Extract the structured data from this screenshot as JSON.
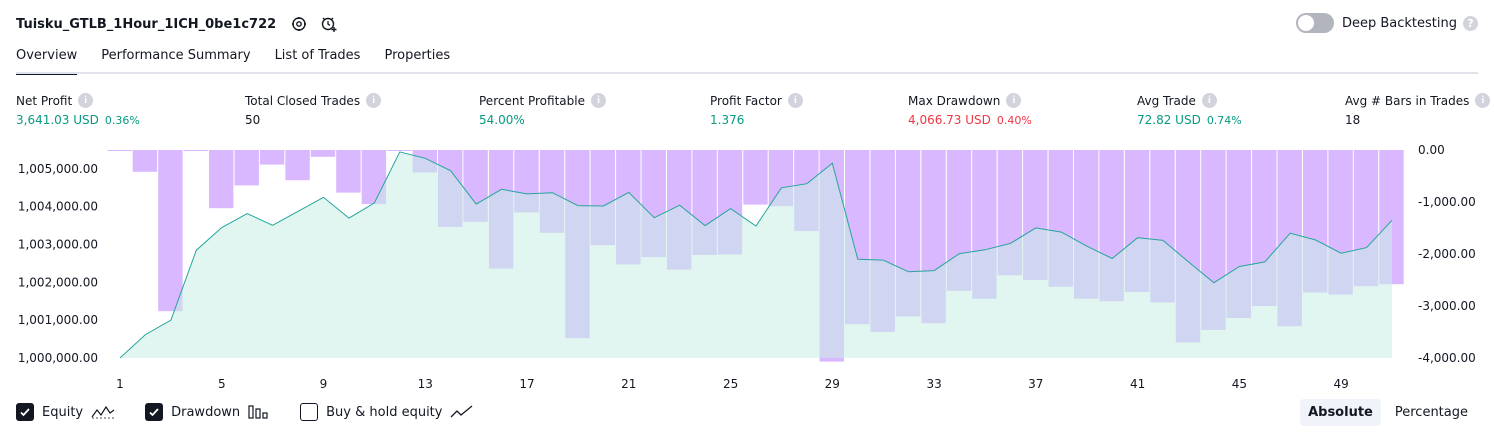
{
  "header": {
    "strategy_name": "Tuisku_GTLB_1Hour_1ICH_0be1c722",
    "deep_backtesting_label": "Deep Backtesting"
  },
  "tabs": [
    {
      "label": "Overview",
      "active": true
    },
    {
      "label": "Performance Summary",
      "active": false
    },
    {
      "label": "List of Trades",
      "active": false
    },
    {
      "label": "Properties",
      "active": false
    }
  ],
  "metrics": {
    "net_profit": {
      "label": "Net Profit",
      "value": "3,641.03 USD",
      "pct": "0.36%"
    },
    "total_closed_trades": {
      "label": "Total Closed Trades",
      "value": "50"
    },
    "percent_profitable": {
      "label": "Percent Profitable",
      "value": "54.00%"
    },
    "profit_factor": {
      "label": "Profit Factor",
      "value": "1.376"
    },
    "max_drawdown": {
      "label": "Max Drawdown",
      "value": "4,066.73 USD",
      "pct": "0.40%"
    },
    "avg_trade": {
      "label": "Avg Trade",
      "value": "72.82 USD",
      "pct": "0.74%"
    },
    "avg_bars": {
      "label": "Avg # Bars in Trades",
      "value": "18"
    }
  },
  "colors": {
    "equity_line": "#26a69a",
    "equity_fill": "#c8ede5",
    "drawdown_bar": "#d9b8ff",
    "positive": "#089981",
    "negative": "#f23645"
  },
  "legend": {
    "equity": {
      "label": "Equity",
      "checked": true,
      "icon": "equity-line-icon"
    },
    "drawdown": {
      "label": "Drawdown",
      "checked": true,
      "icon": "drawdown-bars-icon"
    },
    "buy_hold": {
      "label": "Buy & hold equity",
      "checked": false,
      "icon": "buy-hold-line-icon"
    }
  },
  "mode": {
    "absolute_label": "Absolute",
    "percentage_label": "Percentage",
    "selected": "Absolute"
  },
  "chart_data": {
    "type": "line",
    "x": [
      1,
      2,
      3,
      4,
      5,
      6,
      7,
      8,
      9,
      10,
      11,
      12,
      13,
      14,
      15,
      16,
      17,
      18,
      19,
      20,
      21,
      22,
      23,
      24,
      25,
      26,
      27,
      28,
      29,
      30,
      31,
      32,
      33,
      34,
      35,
      36,
      37,
      38,
      39,
      40,
      41,
      42,
      43,
      44,
      45,
      46,
      47,
      48,
      49,
      50,
      51
    ],
    "x_ticks": [
      "1",
      "5",
      "9",
      "13",
      "17",
      "21",
      "25",
      "29",
      "33",
      "37",
      "41",
      "45",
      "49"
    ],
    "y_left_ticks": [
      "1,000,000.00",
      "1,001,000.00",
      "1,002,000.00",
      "1,003,000.00",
      "1,004,000.00",
      "1,005,000.00"
    ],
    "y_right_ticks": [
      "0.00",
      "-1,000.00",
      "-2,000.00",
      "-3,000.00",
      "-4,000.00"
    ],
    "ylim_left": [
      1000000,
      1005500
    ],
    "ylim_right": [
      -4000,
      0
    ],
    "series": [
      {
        "values": [
          1000000,
          1000620,
          1001000,
          1002850,
          1003450,
          1003820,
          1003510,
          1003880,
          1004250,
          1003700,
          1004100,
          1005450,
          1005280,
          1004950,
          1004070,
          1004460,
          1004340,
          1004370,
          1004030,
          1004020,
          1004380,
          1003710,
          1004040,
          1003500,
          1003950,
          1003490,
          1004500,
          1004610,
          1005150,
          1002610,
          1002590,
          1002280,
          1002310,
          1002760,
          1002860,
          1003030,
          1003440,
          1003330,
          1002960,
          1002630,
          1003180,
          1003110,
          1002540,
          1001990,
          1002420,
          1002540,
          1003300,
          1003120,
          1002770,
          1002920,
          1003641
        ]
      },
      {
        "values": [
          0,
          -420,
          -3100,
          -20,
          -1120,
          -680,
          -280,
          -580,
          -130,
          -820,
          -1040,
          0,
          -430,
          -1480,
          -1380,
          -2280,
          -1200,
          -1590,
          -3620,
          -1830,
          -2200,
          -2060,
          -2300,
          -2020,
          -2010,
          -1050,
          -1080,
          -1560,
          -4070,
          -3350,
          -3500,
          -3200,
          -3330,
          -2710,
          -2860,
          -2410,
          -2500,
          -2630,
          -2860,
          -2910,
          -2730,
          -2930,
          -3700,
          -3460,
          -3230,
          -3000,
          -3390,
          -2740,
          -2780,
          -2620,
          -2580
        ]
      }
    ]
  }
}
